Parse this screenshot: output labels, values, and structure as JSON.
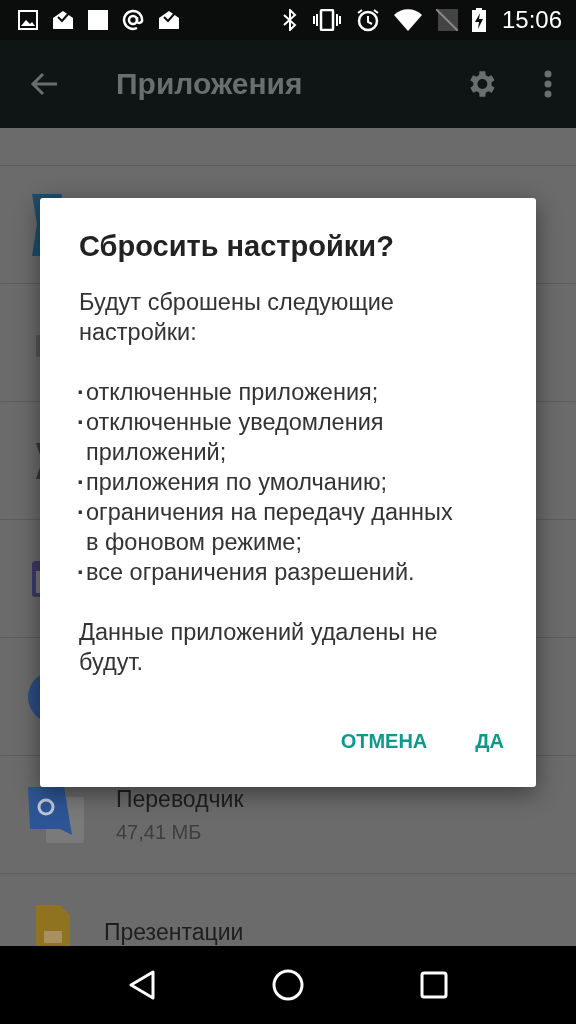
{
  "status_bar": {
    "time": "15:06"
  },
  "app_bar": {
    "title": "Приложения"
  },
  "app_list": [
    {
      "name": "Переводчик",
      "size": "47,41 МБ"
    },
    {
      "name": "Презентации"
    }
  ],
  "dialog": {
    "title": "Сбросить настройки?",
    "intro": "Будут сброшены следующие настройки:",
    "items": [
      {
        "marker": "·",
        "text": "отключенные приложения;"
      },
      {
        "marker": "·",
        "text": "отключенные уведомления приложений;"
      },
      {
        "marker": "·",
        "text": "приложения по умолчанию;"
      },
      {
        "marker": "·",
        "text": "ограничения на передачу данных в фоновом режиме;"
      },
      {
        "marker": "·",
        "text": "все ограничения разрешений."
      }
    ],
    "note": "Данные приложений удалены не будут.",
    "buttons": [
      "ОТМЕНА",
      "ДА"
    ]
  }
}
